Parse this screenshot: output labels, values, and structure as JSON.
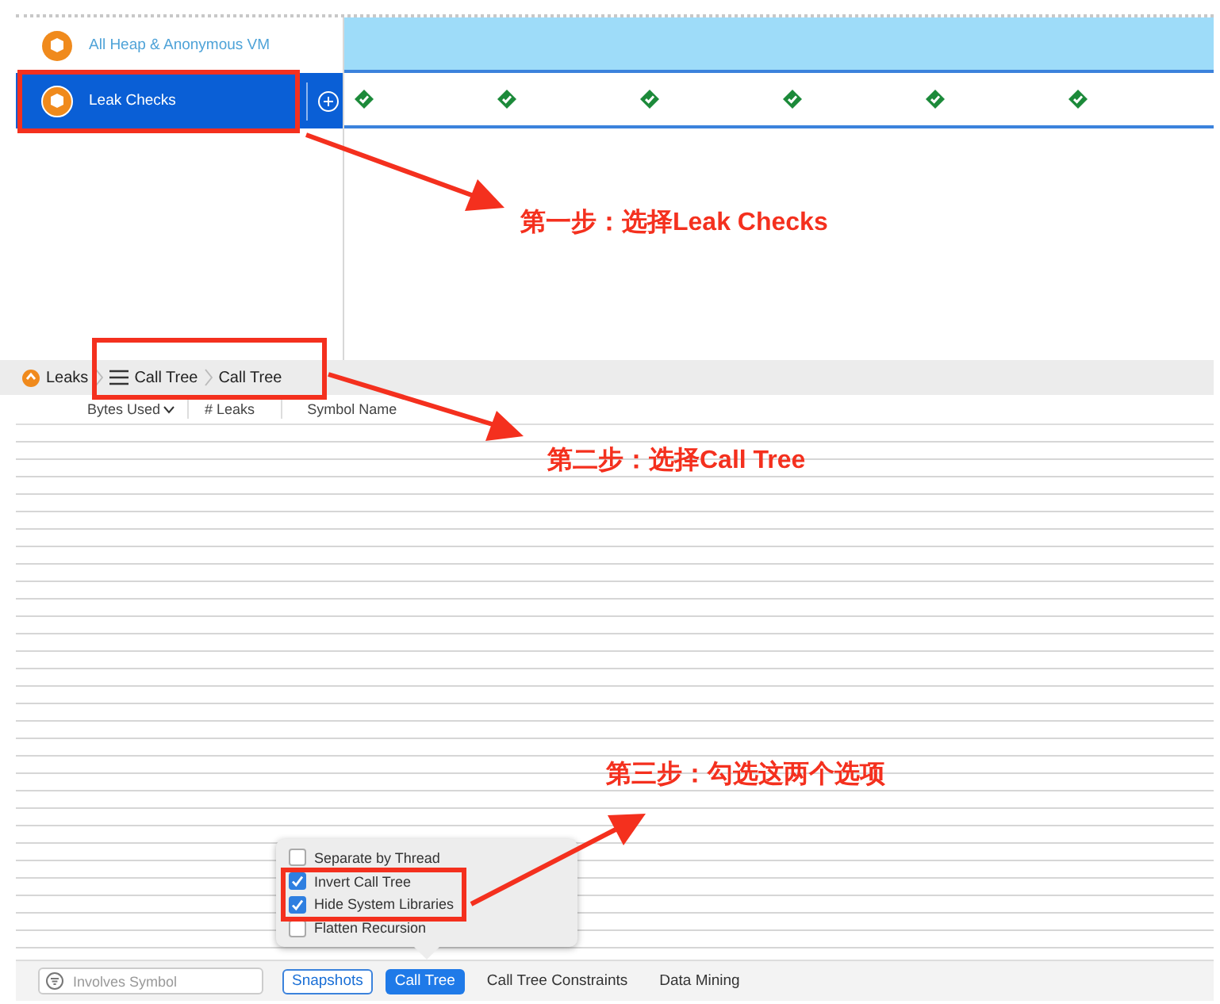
{
  "tracks": [
    {
      "label": "All Heap & Anonymous VM",
      "selected": false
    },
    {
      "label": "Leak Checks",
      "selected": true
    }
  ],
  "leak_checks": [
    {
      "passed": true
    },
    {
      "passed": true
    },
    {
      "passed": true
    },
    {
      "passed": true
    },
    {
      "passed": true
    },
    {
      "passed": true
    }
  ],
  "breadcrumb": {
    "instrument": "Leaks",
    "items": [
      "Call Tree",
      "Call Tree"
    ]
  },
  "columns": [
    {
      "label": "Bytes Used",
      "sorted": true
    },
    {
      "label": "# Leaks",
      "sorted": false
    },
    {
      "label": "Symbol Name",
      "sorted": false
    }
  ],
  "popover": {
    "options": [
      {
        "label": "Separate by Thread",
        "checked": false
      },
      {
        "label": "Invert Call Tree",
        "checked": true
      },
      {
        "label": "Hide System Libraries",
        "checked": true
      },
      {
        "label": "Flatten Recursion",
        "checked": false
      }
    ]
  },
  "bottom_bar": {
    "filter": {
      "placeholder": "Involves Symbol"
    },
    "tabs": [
      {
        "label": "Snapshots",
        "kind": "toggle",
        "selected": true
      },
      {
        "label": "Call Tree",
        "kind": "tab",
        "selected": true
      },
      {
        "label": "Call Tree Constraints",
        "kind": "tab",
        "selected": false
      },
      {
        "label": "Data Mining",
        "kind": "tab",
        "selected": false
      }
    ]
  },
  "annotations": [
    {
      "text": "第一步：选择Leak Checks"
    },
    {
      "text": "第二步：选择Call Tree"
    },
    {
      "text": "第三步：勾选这两个选项"
    }
  ]
}
